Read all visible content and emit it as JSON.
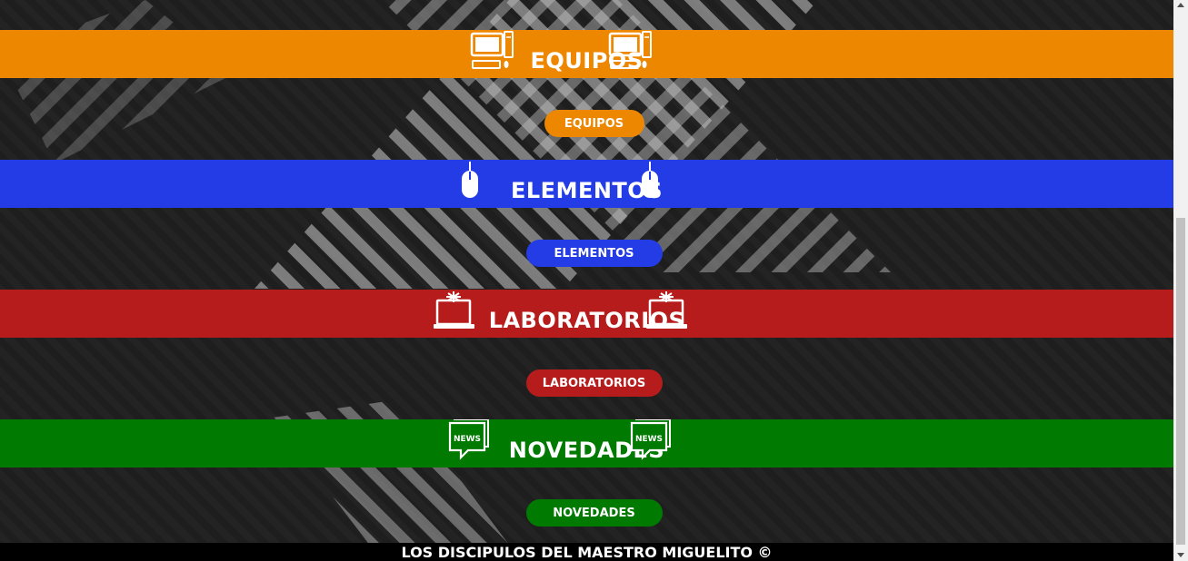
{
  "sections": [
    {
      "title": "EQUIPOS",
      "button": "EQUIPOS",
      "color": "#EE8700",
      "icon": "desktop-computer-icon"
    },
    {
      "title": "ELEMENTOS",
      "button": "ELEMENTOS",
      "color": "#233CE6",
      "icon": "mouse-icon"
    },
    {
      "title": "LABORATORIOS",
      "button": "LABORATORIOS",
      "color": "#B71C1C",
      "icon": "broken-laptop-icon"
    },
    {
      "title": "NOVEDADES",
      "button": "NOVEDADES",
      "color": "#007A00",
      "icon": "news-icon"
    }
  ],
  "news_icon_text": "NEWS",
  "footer": {
    "text": "LOS DISCIPULOS DEL MAESTRO MIGUELITO ©"
  }
}
